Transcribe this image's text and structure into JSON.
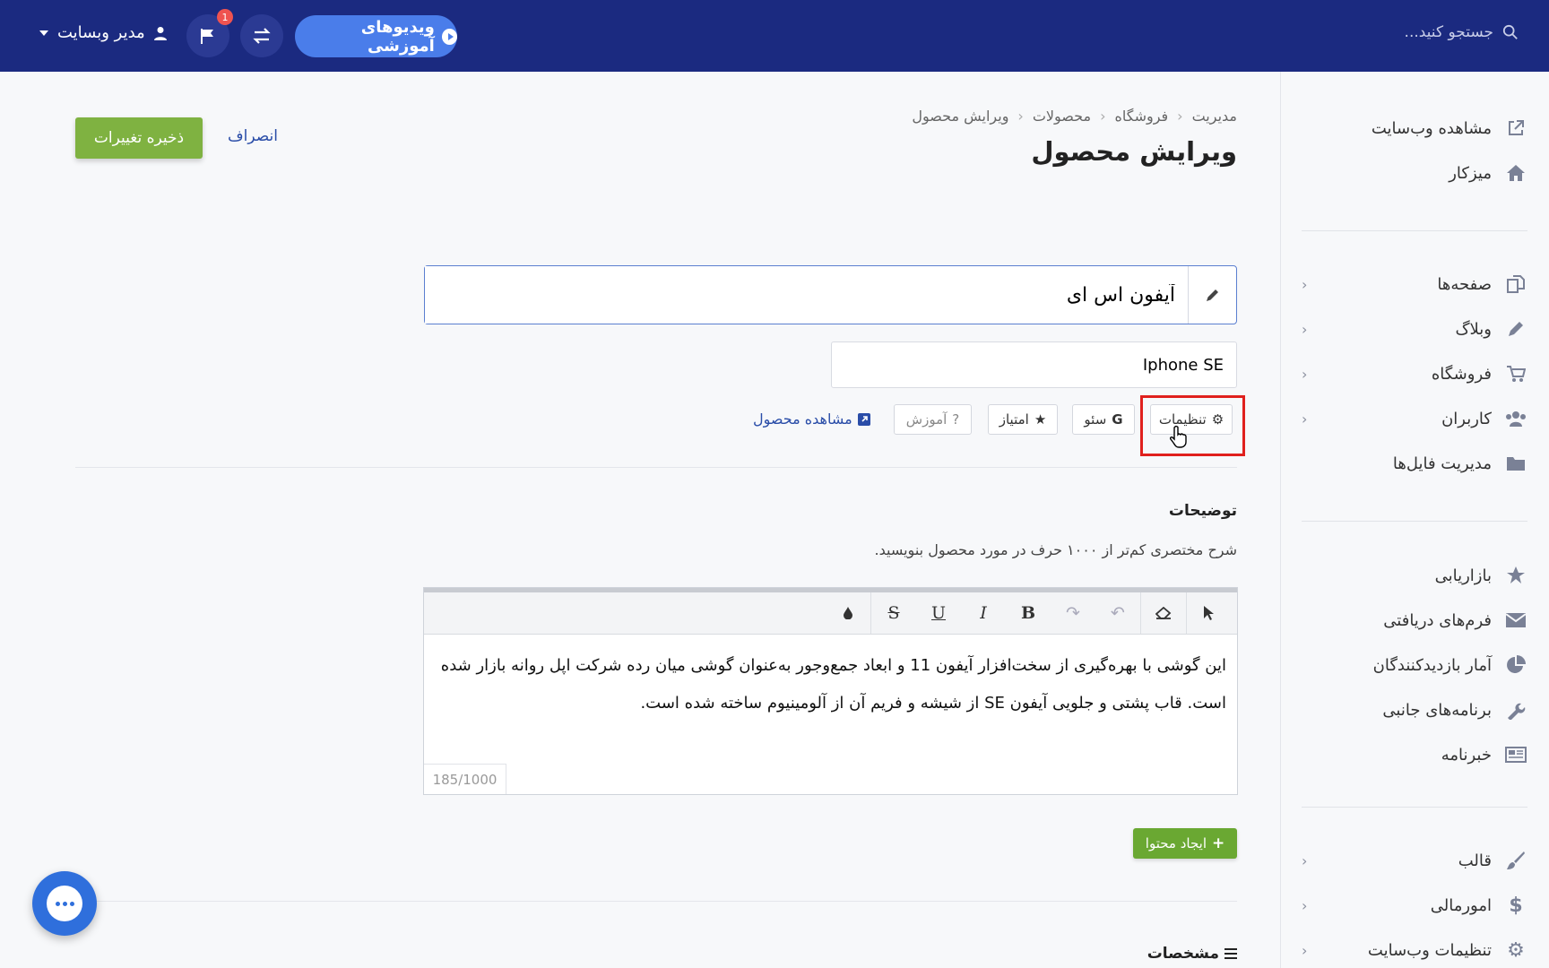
{
  "header": {
    "search_placeholder": "جستجو کنید...",
    "videos_button": "ویدیوهای آموزشی",
    "notification_count": "1",
    "user_label": "مدیر وبسایت"
  },
  "sidebar": {
    "items": [
      {
        "label": "مشاهده وب‌سایت",
        "icon": "external-link-icon"
      },
      {
        "label": "میزکار",
        "icon": "home-icon"
      },
      {
        "label": "صفحه‌ها",
        "icon": "pages-icon"
      },
      {
        "label": "وبلاگ",
        "icon": "pencil-icon"
      },
      {
        "label": "فروشگاه",
        "icon": "cart-icon"
      },
      {
        "label": "کاربران",
        "icon": "users-icon"
      },
      {
        "label": "مدیریت فایل‌ها",
        "icon": "folder-icon"
      },
      {
        "label": "بازاریابی",
        "icon": "star-icon"
      },
      {
        "label": "فرم‌های دریافتی",
        "icon": "envelope-icon"
      },
      {
        "label": "آمار بازدیدکنندگان",
        "icon": "pie-chart-icon"
      },
      {
        "label": "برنامه‌های جانبی",
        "icon": "wrench-icon"
      },
      {
        "label": "خبرنامه",
        "icon": "newspaper-icon"
      },
      {
        "label": "قالب",
        "icon": "brush-icon"
      },
      {
        "label": "امورمالی",
        "icon": "dollar-icon"
      },
      {
        "label": "تنظیمات وب‌سایت",
        "icon": "gear-icon"
      }
    ]
  },
  "breadcrumb": [
    "مدیریت",
    "فروشگاه",
    "محصولات",
    "ویرایش محصول"
  ],
  "page": {
    "title": "ویرایش محصول",
    "save_label": "ذخیره تغییرات",
    "cancel_label": "انصراف"
  },
  "product": {
    "name": "آیفون اس ای",
    "slug": "Iphone SE"
  },
  "tabs": {
    "settings": "تنظیمات",
    "seo": "سئو",
    "rating": "امتیاز",
    "tutorial": "آموزش",
    "view_product": "مشاهده محصول"
  },
  "description": {
    "title": "توضیحات",
    "hint": "شرح مختصری کم‌تر از ۱۰۰۰ حرف در مورد محصول بنویسید.",
    "body": "این گوشی با بهره‌گیری از سخت‌افزار آیفون 11 و ابعاد جمع‌وجور به‌عنوان گوشی میان رده شرکت اپل روانه بازار شده است. قاب پشتی و جلویی آیفون SE از شیشه و فریم آن از آلومینیوم ساخته شده است.",
    "counter": "185/1000",
    "create_content": "ایجاد محتوا"
  },
  "specs_title": "مشخصات",
  "colors": {
    "topbar": "#1b2a80",
    "accent_blue": "#4a7dea",
    "save_green": "#7fb241",
    "highlight_red": "#e0201d"
  }
}
